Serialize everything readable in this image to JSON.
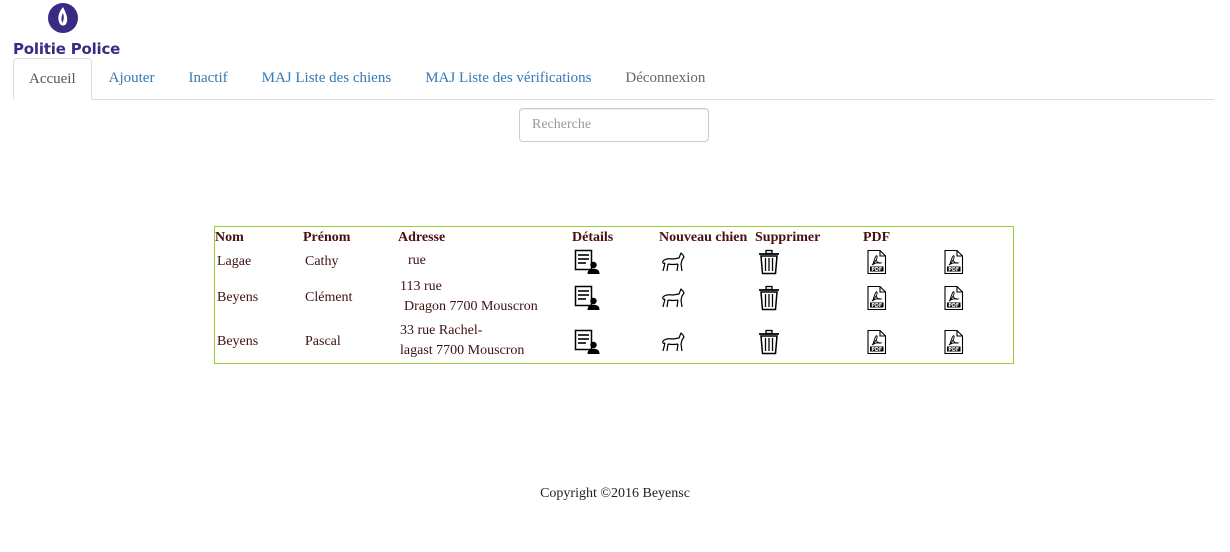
{
  "brand": {
    "name": "Politie Police",
    "color": "#3b2a83"
  },
  "nav": {
    "tabs": [
      {
        "label": "Accueil",
        "state": "active"
      },
      {
        "label": "Ajouter"
      },
      {
        "label": "Inactif"
      },
      {
        "label": "MAJ Liste des chiens"
      },
      {
        "label": "MAJ Liste des vérifications"
      },
      {
        "label": "Déconnexion"
      }
    ]
  },
  "search": {
    "placeholder": "Recherche",
    "value": ""
  },
  "table": {
    "headers": [
      "Nom",
      "Prénom",
      "Adresse",
      "Détails",
      "Nouveau chien",
      "Supprimer",
      "PDF"
    ],
    "rows": [
      {
        "nom": "Lagae",
        "prenom": "Cathy",
        "adresse_l1": "rue",
        "adresse_l2": ""
      },
      {
        "nom": "Beyens",
        "prenom": "Clément",
        "adresse_l1": "113  rue",
        "adresse_l2": "Dragon 7700 Mouscron"
      },
      {
        "nom": "Beyens",
        "prenom": "Pascal",
        "adresse_l1": "33  rue  Rachel-",
        "adresse_l2": "lagast 7700 Mouscron"
      }
    ],
    "row_icons": [
      "details-icon",
      "dog-icon",
      "trash-icon",
      "pdf-icon",
      "pdf-icon"
    ],
    "border_color": "#9acd32"
  },
  "footer": {
    "text": "Copyright ©2016 Beyensc"
  }
}
